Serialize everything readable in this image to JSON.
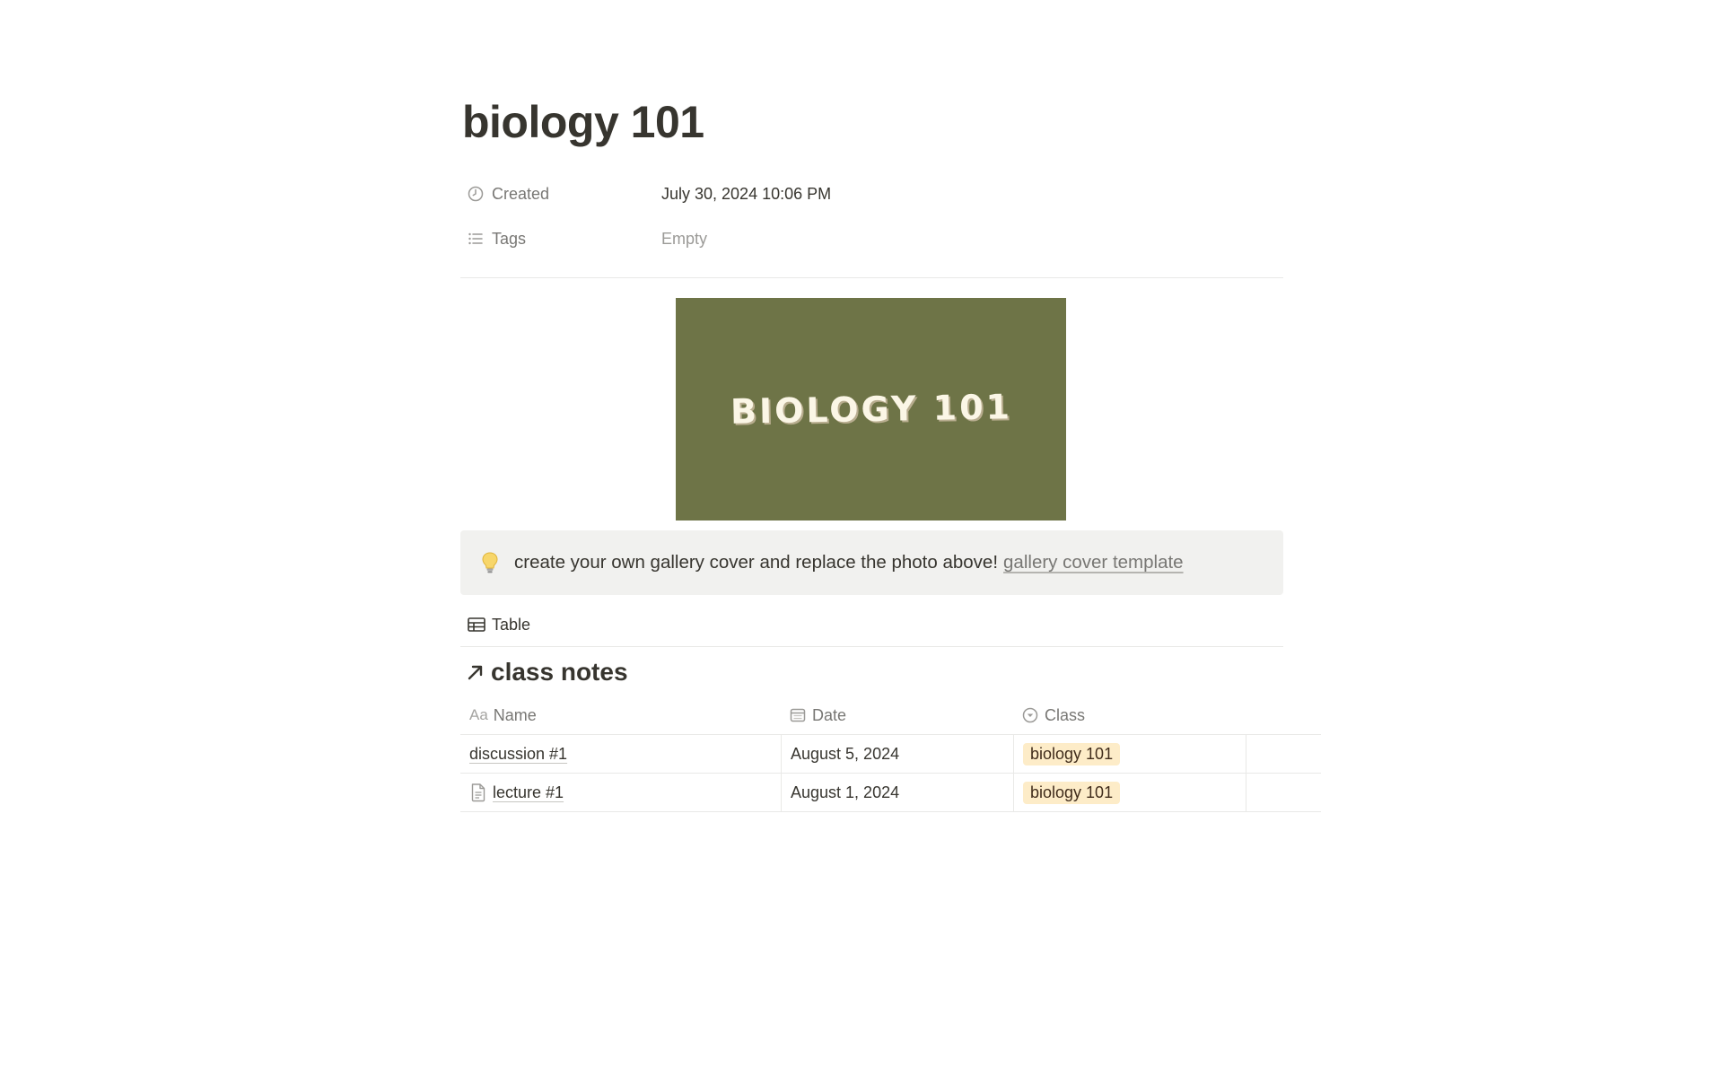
{
  "page": {
    "title": "biology 101"
  },
  "properties": [
    {
      "icon": "clock-icon",
      "label": "Created",
      "value": "July 30, 2024 10:06 PM",
      "empty": false
    },
    {
      "icon": "list-icon",
      "label": "Tags",
      "value": "Empty",
      "empty": true
    }
  ],
  "cover": {
    "text": "BIOLOGY 101",
    "background": "#6e7447"
  },
  "callout": {
    "icon": "lightbulb-icon",
    "text": "create your own gallery cover and replace the photo above!",
    "link_text": "gallery cover template"
  },
  "view_tab": {
    "icon": "table-icon",
    "label": "Table"
  },
  "database": {
    "icon": "arrow-up-right-icon",
    "title": "class notes",
    "columns": [
      {
        "icon": "text-aa-icon",
        "label": "Name"
      },
      {
        "icon": "calendar-icon",
        "label": "Date"
      },
      {
        "icon": "select-icon",
        "label": "Class"
      }
    ],
    "rows": [
      {
        "name": "discussion #1",
        "has_page_icon": false,
        "date": "August 5, 2024",
        "class": "biology 101"
      },
      {
        "name": "lecture #1",
        "has_page_icon": true,
        "date": "August 1, 2024",
        "class": "biology 101"
      }
    ],
    "tag_color": "#fdecc8"
  }
}
